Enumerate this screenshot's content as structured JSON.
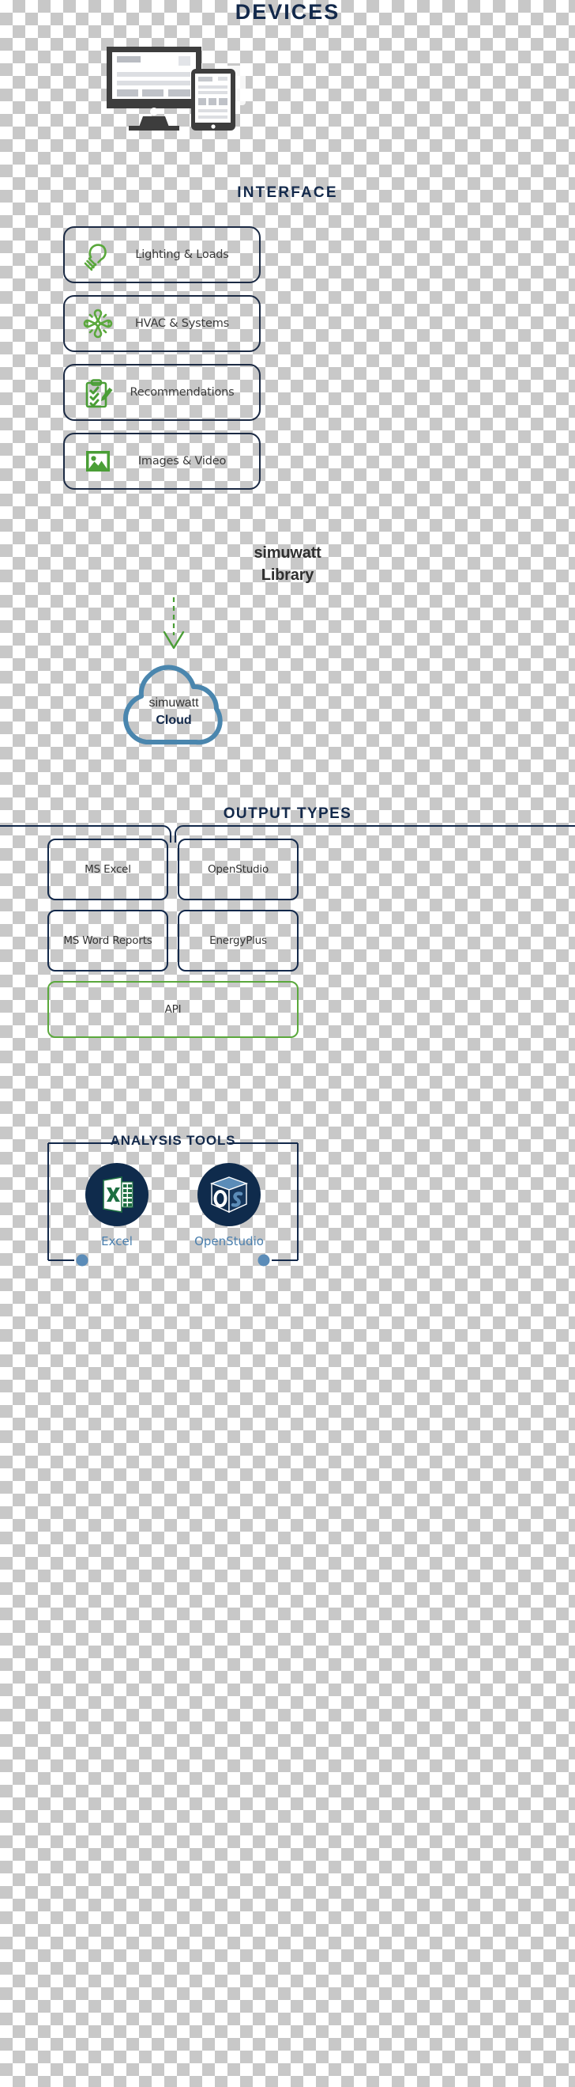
{
  "sections": {
    "devices": {
      "title": "DEVICES"
    },
    "interface": {
      "title": "INTERFACE",
      "cards": [
        {
          "label": "Lighting & Loads",
          "icon": "lightbulb-icon"
        },
        {
          "label": "HVAC & Systems",
          "icon": "fan-icon"
        },
        {
          "label": "Recommendations",
          "icon": "clipboard-check-pencil-icon"
        },
        {
          "label": "Images & Video",
          "icon": "photo-icon"
        }
      ]
    },
    "library": {
      "line1": "simuwatt",
      "line2": "Library",
      "arrow": "dashed-down-arrow-icon"
    },
    "cloud": {
      "line1": "simuwatt",
      "line2": "Cloud",
      "icon": "cloud-outline-icon"
    },
    "output": {
      "title": "OUTPUT TYPES",
      "boxes": [
        {
          "label": "MS Excel",
          "accent": "#13294b"
        },
        {
          "label": "OpenStudio",
          "accent": "#13294b"
        },
        {
          "label": "MS Word Reports",
          "accent": "#13294b"
        },
        {
          "label": "EnergyPlus",
          "accent": "#13294b"
        }
      ],
      "api_box": {
        "label": "API",
        "accent": "#5aa83c"
      }
    },
    "analysis_tools": {
      "title": "ANALYSIS TOOLS",
      "tools": [
        {
          "label": "Excel",
          "icon": "excel-logo-icon"
        },
        {
          "label": "OpenStudio",
          "icon": "openstudio-logo-icon"
        }
      ]
    }
  },
  "colors": {
    "navy": "#13294b",
    "green": "#5aa83c",
    "steel_blue": "#4a86ae",
    "device_dark": "#3d3d3d",
    "text_gray": "#3a3a3a"
  }
}
